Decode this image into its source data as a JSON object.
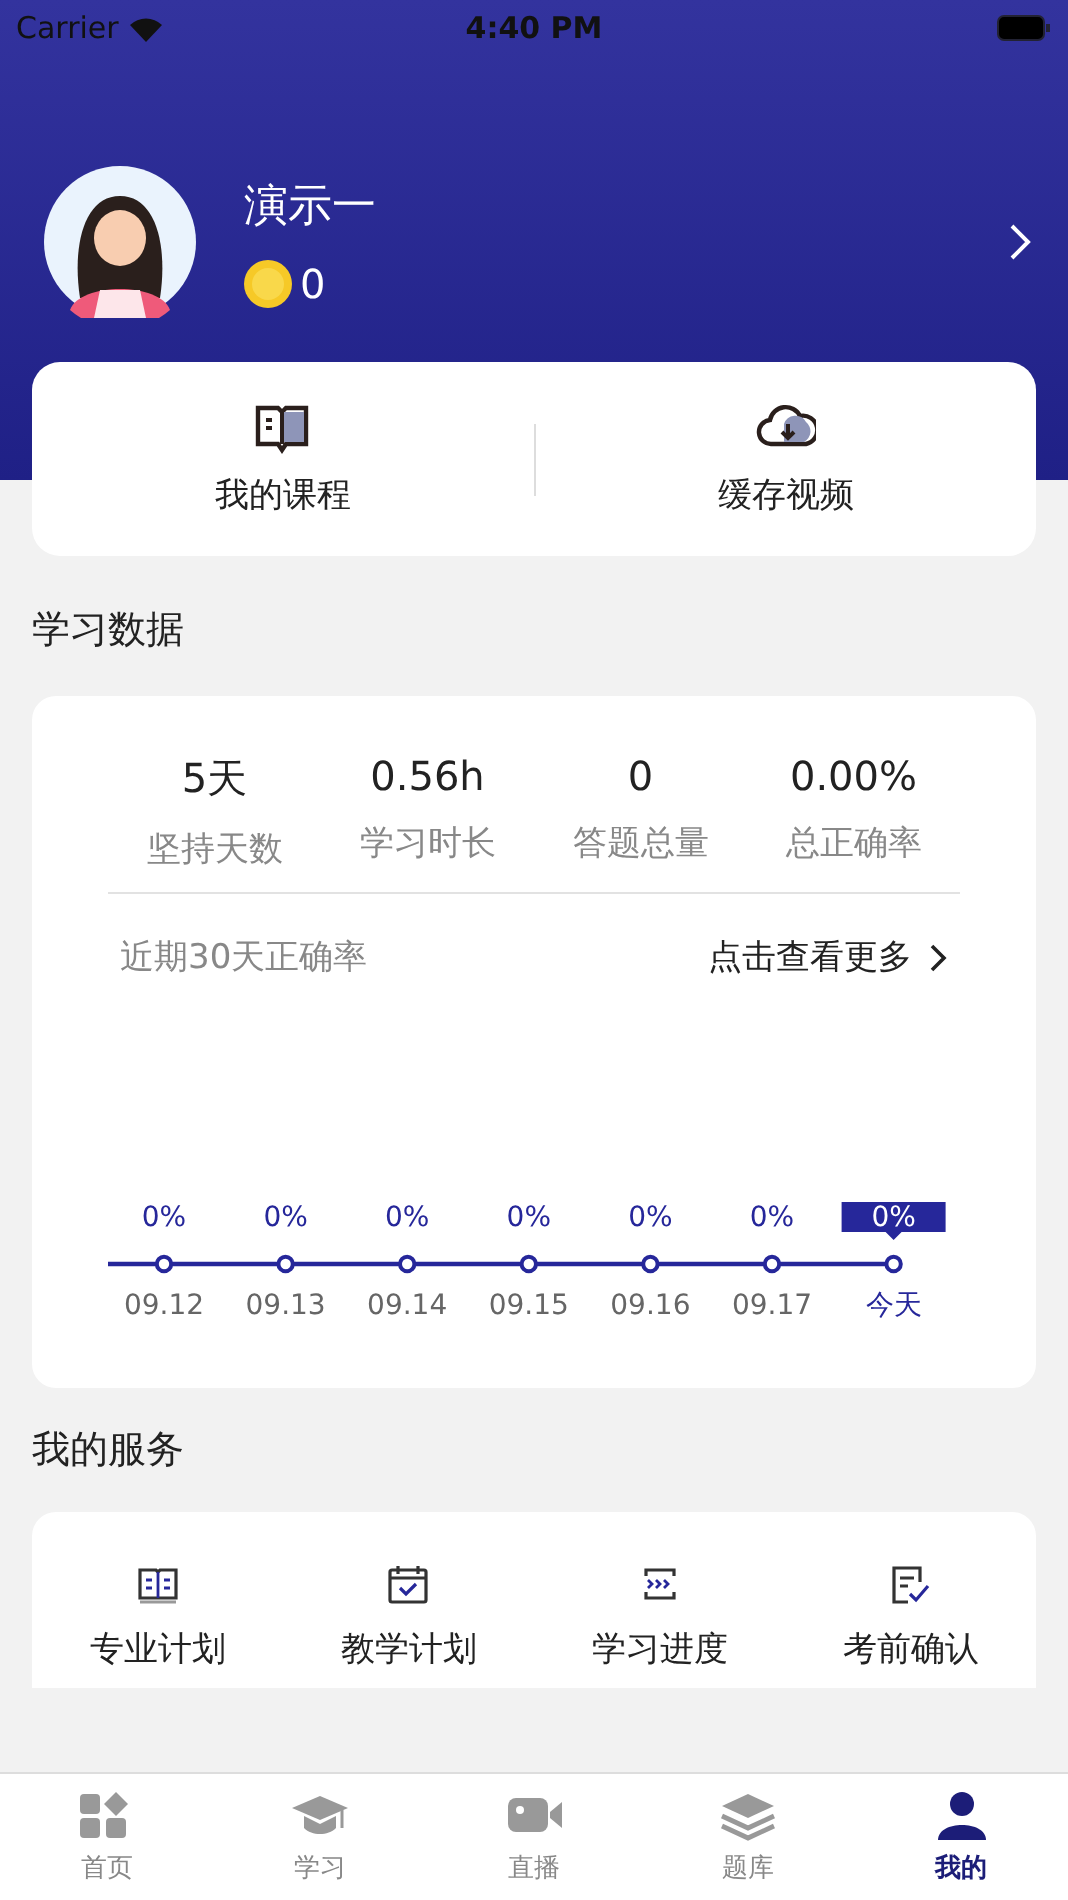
{
  "status_bar": {
    "carrier": "Carrier",
    "time": "4:40 PM"
  },
  "profile": {
    "name": "演示一",
    "coins": "0"
  },
  "quick_links": [
    {
      "label": "我的课程"
    },
    {
      "label": "缓存视频"
    }
  ],
  "study_data": {
    "title": "学习数据",
    "stats": [
      {
        "value": "5天",
        "label": "坚持天数"
      },
      {
        "value": "0.56h",
        "label": "学习时长"
      },
      {
        "value": "0",
        "label": "答题总量"
      },
      {
        "value": "0.00%",
        "label": "总正确率"
      }
    ],
    "chart_title": "近期30天正确率",
    "more_link": "点击查看更多",
    "accuracy_points": [
      {
        "value": "0%",
        "date": "09.12",
        "selected": false
      },
      {
        "value": "0%",
        "date": "09.13",
        "selected": false
      },
      {
        "value": "0%",
        "date": "09.14",
        "selected": false
      },
      {
        "value": "0%",
        "date": "09.15",
        "selected": false
      },
      {
        "value": "0%",
        "date": "09.16",
        "selected": false
      },
      {
        "value": "0%",
        "date": "09.17",
        "selected": false
      },
      {
        "value": "0%",
        "date": "今天",
        "selected": true
      }
    ]
  },
  "services": {
    "title": "我的服务",
    "items": [
      {
        "label": "专业计划"
      },
      {
        "label": "教学计划"
      },
      {
        "label": "学习进度"
      },
      {
        "label": "考前确认"
      }
    ]
  },
  "tab_bar": [
    {
      "label": "首页",
      "selected": false
    },
    {
      "label": "学习",
      "selected": false
    },
    {
      "label": "直播",
      "selected": false
    },
    {
      "label": "题库",
      "selected": false
    },
    {
      "label": "我的",
      "selected": true
    }
  ]
}
